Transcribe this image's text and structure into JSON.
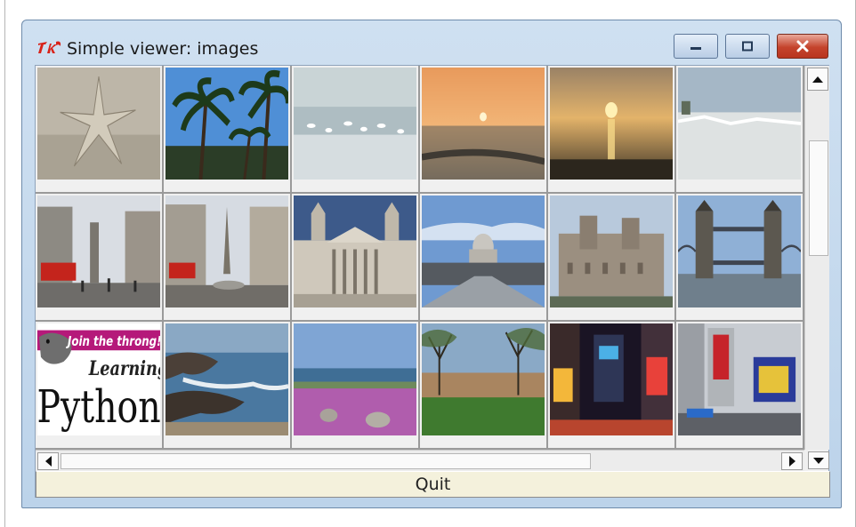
{
  "window": {
    "title": "Simple viewer: images",
    "app_icon": "tk-feather-logo",
    "controls": [
      "minimize-icon",
      "maximize-icon",
      "close-icon"
    ]
  },
  "thumbnails": [
    {
      "name": "starfish-beach"
    },
    {
      "name": "palm-trees"
    },
    {
      "name": "birds-shore"
    },
    {
      "name": "beach-sunset-orange"
    },
    {
      "name": "beach-sunset-gold"
    },
    {
      "name": "white-beach"
    },
    {
      "name": "london-street-red-bus"
    },
    {
      "name": "london-square"
    },
    {
      "name": "st-pauls-facade"
    },
    {
      "name": "millennium-bridge-st-pauls"
    },
    {
      "name": "tower-of-london"
    },
    {
      "name": "tower-bridge"
    },
    {
      "name": "learning-python-cover",
      "banner_text": "Join the throng!",
      "text_line1": "Learning",
      "text_line2": "Python"
    },
    {
      "name": "rocky-coast"
    },
    {
      "name": "purple-flowers-coast"
    },
    {
      "name": "park-trees"
    },
    {
      "name": "times-square-night"
    },
    {
      "name": "times-square-day"
    }
  ],
  "quit_button": {
    "label": "Quit"
  },
  "scrollbars": {
    "vertical": [
      "scroll-up-icon",
      "scroll-down-icon"
    ],
    "horizontal": [
      "scroll-left-icon",
      "scroll-right-icon"
    ]
  }
}
